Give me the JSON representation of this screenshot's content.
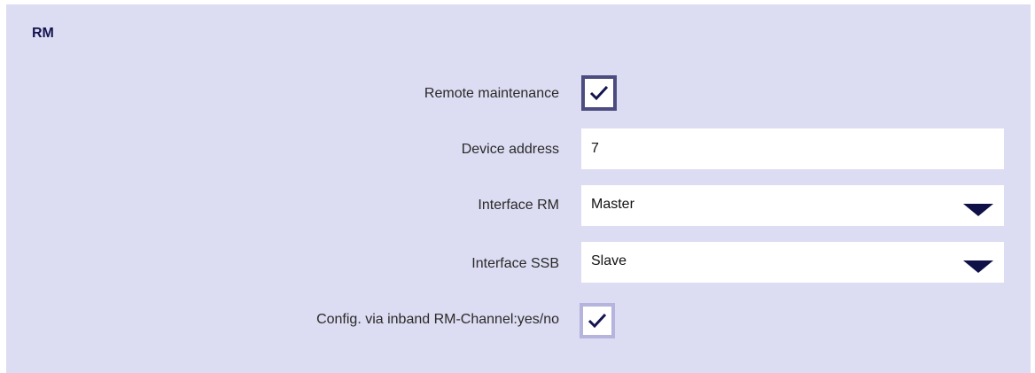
{
  "section": {
    "title": "RM"
  },
  "fields": {
    "remote_maintenance": {
      "label": "Remote maintenance",
      "checked": true
    },
    "device_address": {
      "label": "Device address",
      "value": "7"
    },
    "interface_rm": {
      "label": "Interface RM",
      "selected": "Master"
    },
    "interface_ssb": {
      "label": "Interface SSB",
      "selected": "Slave"
    },
    "config_inband": {
      "label": "Config. via inband RM-Channel:yes/no",
      "checked": true
    }
  },
  "icons": {
    "check": "checkmark-icon",
    "dropdown": "triangle-down-icon"
  },
  "colors": {
    "panel_background": "#dcdcf2",
    "checkbox_border_active": "#4c4c80",
    "checkbox_border_light": "#b4b4dc",
    "caret": "#101048"
  }
}
